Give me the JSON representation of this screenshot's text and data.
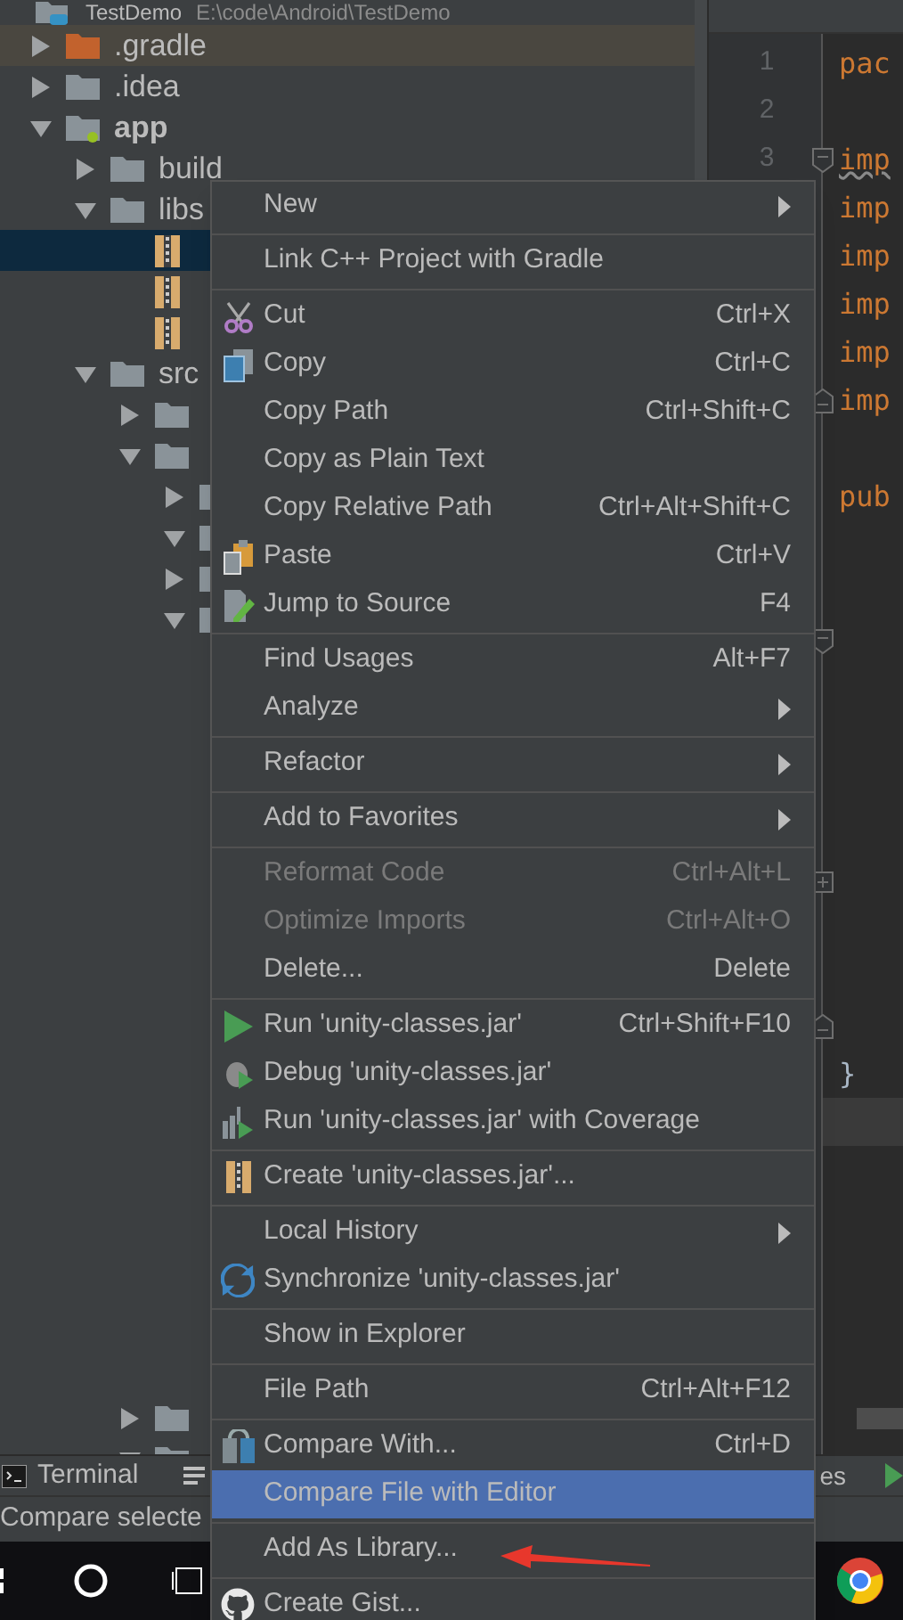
{
  "project_tree": {
    "root": {
      "kind": "project",
      "name": "TestDemo",
      "path": "E:\\code\\Android\\TestDemo",
      "children": [
        {
          "kind": "excluded_folder",
          "name": ".gradle",
          "expanded": false,
          "highlighted": true
        },
        {
          "kind": "folder",
          "name": ".idea",
          "expanded": false
        },
        {
          "kind": "module",
          "name": "app",
          "expanded": true,
          "children": [
            {
              "kind": "folder",
              "name": "build",
              "expanded": false
            },
            {
              "kind": "folder",
              "name": "libs",
              "expanded": true,
              "children": [
                {
                  "kind": "jar",
                  "selected": true
                },
                {
                  "kind": "jar",
                  "selected": false
                },
                {
                  "kind": "jar",
                  "selected": false
                }
              ]
            },
            {
              "kind": "folder",
              "name": "src",
              "expanded": true,
              "children": [
                {
                  "kind": "folder",
                  "expanded": false
                },
                {
                  "kind": "folder",
                  "expanded": true,
                  "children": [
                    {
                      "kind": "folder",
                      "expanded": false
                    },
                    {
                      "kind": "folder",
                      "expanded": true
                    },
                    {
                      "kind": "folder",
                      "expanded": false
                    },
                    {
                      "kind": "folder",
                      "expanded": true
                    }
                  ]
                }
              ]
            }
          ]
        }
      ]
    },
    "tail": [
      {
        "kind": "folder",
        "expanded": false
      },
      {
        "kind": "folder",
        "expanded": true
      }
    ]
  },
  "editor": {
    "lines": [
      {
        "number": "1",
        "kind": "code",
        "text": "pac"
      },
      {
        "number": "2",
        "kind": "blank"
      },
      {
        "number": "3",
        "kind": "code",
        "text": "imp",
        "underlined": true,
        "fold_start": true
      },
      {
        "kind": "code",
        "text": "imp"
      },
      {
        "kind": "code",
        "text": "imp"
      },
      {
        "kind": "code",
        "text": "imp"
      },
      {
        "kind": "code",
        "text": "imp"
      },
      {
        "kind": "code",
        "text": "imp",
        "fold_end": true
      },
      {
        "kind": "blank"
      },
      {
        "kind": "code",
        "text": "pub"
      },
      {
        "kind": "blank"
      },
      {
        "kind": "blank"
      },
      {
        "kind": "blank",
        "fold_start": true
      },
      {
        "kind": "blank"
      },
      {
        "kind": "blank"
      },
      {
        "kind": "blank"
      },
      {
        "kind": "blank"
      },
      {
        "kind": "blank",
        "folded": true
      },
      {
        "kind": "blank"
      },
      {
        "kind": "blank"
      },
      {
        "kind": "blank",
        "fold_end": true
      },
      {
        "kind": "brace",
        "text": "}"
      },
      {
        "kind": "blank",
        "current": true
      }
    ]
  },
  "context_menu": {
    "items": [
      {
        "kind": "item",
        "label": "New",
        "submenu": true
      },
      {
        "kind": "separator"
      },
      {
        "kind": "item",
        "label": "Link C++ Project with Gradle"
      },
      {
        "kind": "separator"
      },
      {
        "kind": "item",
        "label": "Cut",
        "shortcut": "Ctrl+X"
      },
      {
        "kind": "item",
        "label": "Copy",
        "shortcut": "Ctrl+C"
      },
      {
        "kind": "item",
        "label": "Copy Path",
        "shortcut": "Ctrl+Shift+C"
      },
      {
        "kind": "item",
        "label": "Copy as Plain Text"
      },
      {
        "kind": "item",
        "label": "Copy Relative Path",
        "shortcut": "Ctrl+Alt+Shift+C"
      },
      {
        "kind": "item",
        "label": "Paste",
        "shortcut": "Ctrl+V"
      },
      {
        "kind": "item",
        "label": "Jump to Source",
        "shortcut": "F4"
      },
      {
        "kind": "separator"
      },
      {
        "kind": "item",
        "label": "Find Usages",
        "shortcut": "Alt+F7"
      },
      {
        "kind": "item",
        "label": "Analyze",
        "submenu": true
      },
      {
        "kind": "separator"
      },
      {
        "kind": "item",
        "label": "Refactor",
        "submenu": true
      },
      {
        "kind": "separator"
      },
      {
        "kind": "item",
        "label": "Add to Favorites",
        "submenu": true
      },
      {
        "kind": "separator"
      },
      {
        "kind": "item",
        "label": "Reformat Code",
        "shortcut": "Ctrl+Alt+L",
        "disabled": true
      },
      {
        "kind": "item",
        "label": "Optimize Imports",
        "shortcut": "Ctrl+Alt+O",
        "disabled": true
      },
      {
        "kind": "item",
        "label": "Delete...",
        "shortcut": "Delete"
      },
      {
        "kind": "separator"
      },
      {
        "kind": "item",
        "label": "Run 'unity-classes.jar'",
        "shortcut": "Ctrl+Shift+F10"
      },
      {
        "kind": "item",
        "label": "Debug 'unity-classes.jar'"
      },
      {
        "kind": "item",
        "label": "Run 'unity-classes.jar' with Coverage"
      },
      {
        "kind": "separator"
      },
      {
        "kind": "item",
        "label": "Create 'unity-classes.jar'..."
      },
      {
        "kind": "separator"
      },
      {
        "kind": "item",
        "label": "Local History",
        "submenu": true
      },
      {
        "kind": "item",
        "label": "Synchronize 'unity-classes.jar'"
      },
      {
        "kind": "separator"
      },
      {
        "kind": "item",
        "label": "Show in Explorer"
      },
      {
        "kind": "separator"
      },
      {
        "kind": "item",
        "label": "File Path",
        "shortcut": "Ctrl+Alt+F12"
      },
      {
        "kind": "separator"
      },
      {
        "kind": "item",
        "label": "Compare With...",
        "shortcut": "Ctrl+D"
      },
      {
        "kind": "item",
        "label": "Compare File with Editor",
        "selected": true
      },
      {
        "kind": "separator"
      },
      {
        "kind": "item",
        "label": "Add As Library..."
      },
      {
        "kind": "separator"
      },
      {
        "kind": "item",
        "label": "Create Gist..."
      }
    ]
  },
  "tool_window_bar": {
    "terminal": "Terminal",
    "tab_fragment": "es"
  },
  "status_bar": {
    "message": "Compare selecte"
  }
}
